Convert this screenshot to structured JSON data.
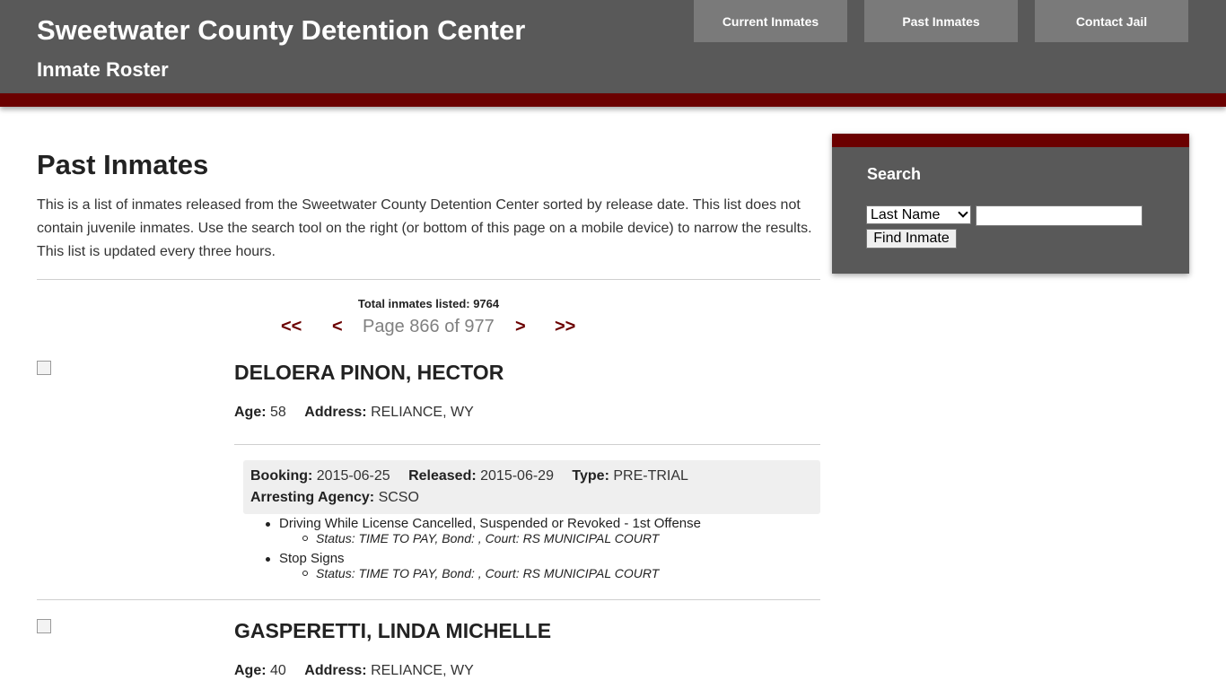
{
  "header": {
    "title": "Sweetwater County Detention Center",
    "subtitle": "Inmate Roster",
    "nav": [
      "Current Inmates",
      "Past Inmates",
      "Contact Jail"
    ]
  },
  "main": {
    "title": "Past Inmates",
    "intro": "This is a list of inmates released from the Sweetwater County Detention Center sorted by release date. This list does not contain juvenile inmates. Use the search tool on the right (or bottom of this page on a mobile device) to narrow the results. This list is updated every three hours.",
    "total": "Total inmates listed: 9764",
    "pager": {
      "first": "<<",
      "prev": "<",
      "page_text": "Page 866 of 977",
      "next": ">",
      "last": ">>"
    }
  },
  "inmates": [
    {
      "name": "DELOERA PINON, HECTOR",
      "age_label": "Age:",
      "age": "58",
      "address_label": "Address:",
      "address": "RELIANCE, WY",
      "booking_label": "Booking:",
      "booking": "2015-06-25",
      "released_label": "Released:",
      "released": "2015-06-29",
      "type_label": "Type:",
      "type": "PRE-TRIAL",
      "agency_label": "Arresting Agency:",
      "agency": "SCSO",
      "charges": [
        {
          "charge": "Driving While License Cancelled, Suspended or Revoked - 1st Offense",
          "status": "Status: TIME TO PAY, Bond: , Court: RS MUNICIPAL COURT"
        },
        {
          "charge": "Stop Signs",
          "status": "Status: TIME TO PAY, Bond: , Court: RS MUNICIPAL COURT"
        }
      ]
    },
    {
      "name": "GASPERETTI, LINDA MICHELLE",
      "age_label": "Age:",
      "age": "40",
      "address_label": "Address:",
      "address": "RELIANCE, WY"
    }
  ],
  "search": {
    "title": "Search",
    "select_value": "Last Name",
    "input_value": "",
    "button": "Find Inmate"
  },
  "colors": {
    "header_bg": "#595959",
    "accent": "#6b0000",
    "nav_button": "#7a7a7a"
  }
}
